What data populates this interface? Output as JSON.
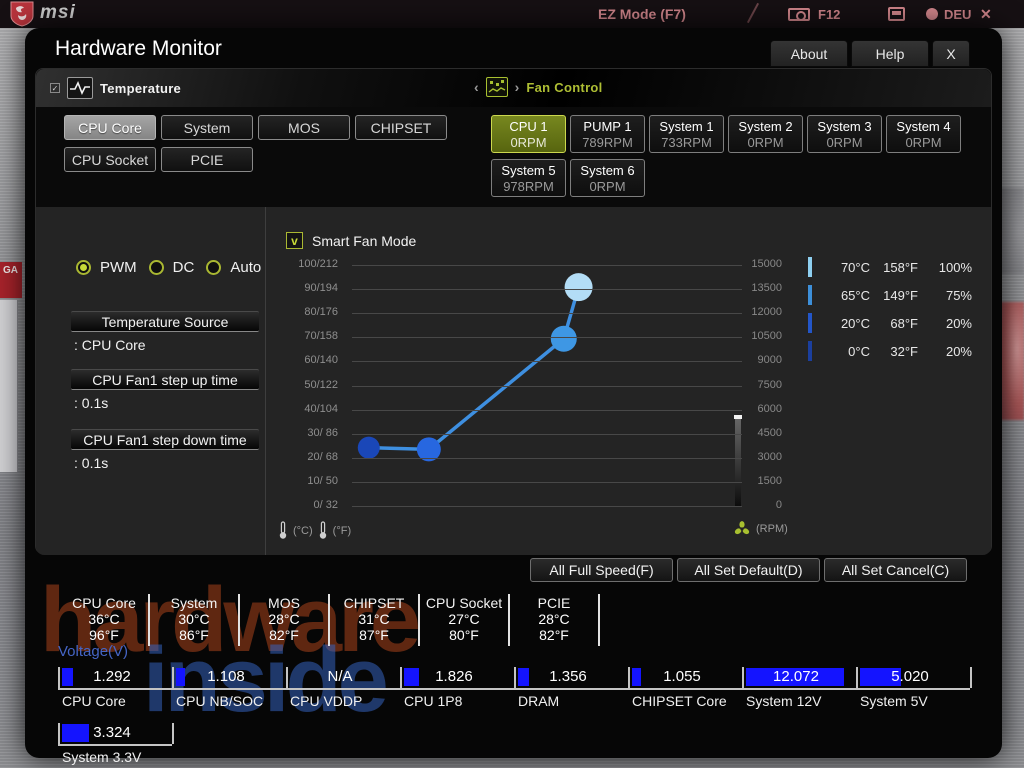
{
  "top_bar": {
    "brand": "msi",
    "ez_mode": "EZ Mode (F7)",
    "f12": "F12",
    "lang": "DEU",
    "close": "✕",
    "ga_badge": "GA"
  },
  "dialog": {
    "title": "Hardware Monitor",
    "tabs": [
      {
        "label": "About"
      },
      {
        "label": "Help"
      },
      {
        "label": "X"
      }
    ]
  },
  "temperature_section": {
    "title": "Temperature",
    "buttons": [
      {
        "label": "CPU Core",
        "selected": true
      },
      {
        "label": "System",
        "selected": false
      },
      {
        "label": "MOS",
        "selected": false
      },
      {
        "label": "CHIPSET",
        "selected": false
      },
      {
        "label": "CPU Socket",
        "selected": false
      },
      {
        "label": "PCIE",
        "selected": false
      }
    ]
  },
  "fan_section": {
    "title": "Fan Control",
    "prev": "‹",
    "next": "›",
    "fans": [
      {
        "name": "CPU 1",
        "rpm": "0RPM",
        "selected": true
      },
      {
        "name": "PUMP 1",
        "rpm": "789RPM",
        "selected": false
      },
      {
        "name": "System 1",
        "rpm": "733RPM",
        "selected": false
      },
      {
        "name": "System 2",
        "rpm": "0RPM",
        "selected": false
      },
      {
        "name": "System 3",
        "rpm": "0RPM",
        "selected": false
      },
      {
        "name": "System 4",
        "rpm": "0RPM",
        "selected": false
      },
      {
        "name": "System 5",
        "rpm": "978RPM",
        "selected": false
      },
      {
        "name": "System 6",
        "rpm": "0RPM",
        "selected": false
      }
    ]
  },
  "fan_controls": {
    "modes": [
      {
        "label": "PWM",
        "selected": true
      },
      {
        "label": "DC",
        "selected": false
      },
      {
        "label": "Auto",
        "selected": false
      }
    ],
    "fields": [
      {
        "button": "Temperature Source",
        "value": ": CPU Core"
      },
      {
        "button": "CPU Fan1 step up time",
        "value": ": 0.1s"
      },
      {
        "button": "CPU Fan1 step down time",
        "value": ": 0.1s"
      }
    ]
  },
  "chart_data": {
    "type": "line",
    "title": "Smart Fan Mode",
    "checkbox_checked": true,
    "check_glyph": "v",
    "x_axis": "Temperature (°C/°F)",
    "y_right_axis": "Fan speed (RPM)",
    "y_left_labels": [
      "100/212",
      "90/194",
      "80/176",
      "70/158",
      "60/140",
      "50/122",
      "40/104",
      "30/ 86",
      "20/ 68",
      "10/ 50",
      "0/ 32"
    ],
    "y_right_labels": [
      "15000",
      "13500",
      "12000",
      "10500",
      "9000",
      "7500",
      "6000",
      "4500",
      "3000",
      "1500",
      "0"
    ],
    "y_right_range": [
      0,
      15000
    ],
    "line_color": "#3e8fe0",
    "points": [
      {
        "temp_c": 0,
        "temp_f": 32,
        "duty_pct": 20,
        "x_pct": 4.3,
        "y_pct": 24.2,
        "r": 11,
        "color": "#1a47b8"
      },
      {
        "temp_c": 20,
        "temp_f": 68,
        "duty_pct": 20,
        "x_pct": 19.7,
        "y_pct": 23.5,
        "r": 12,
        "color": "#2767e0"
      },
      {
        "temp_c": 65,
        "temp_f": 149,
        "duty_pct": 75,
        "x_pct": 54.3,
        "y_pct": 69.4,
        "r": 13,
        "color": "#3e97e4"
      },
      {
        "temp_c": 70,
        "temp_f": 158,
        "duty_pct": 100,
        "x_pct": 58.1,
        "y_pct": 90.8,
        "r": 14,
        "color": "#b3ddf6"
      }
    ],
    "footer": {
      "celsius": "(°C)",
      "fahrenheit": "(°F)",
      "rpm": "(RPM)"
    },
    "legend": [
      {
        "c": "70°C",
        "f": "158°F",
        "pct": "100%",
        "color": "#8ecff0"
      },
      {
        "c": "65°C",
        "f": "149°F",
        "pct": "75%",
        "color": "#3d8fd9"
      },
      {
        "c": "20°C",
        "f": "68°F",
        "pct": "20%",
        "color": "#2356c8"
      },
      {
        "c": "0°C",
        "f": "32°F",
        "pct": "20%",
        "color": "#1b3f9e"
      }
    ]
  },
  "actions": [
    {
      "label": "All Full Speed(F)"
    },
    {
      "label": "All Set Default(D)"
    },
    {
      "label": "All Set Cancel(C)"
    }
  ],
  "monitor": {
    "temps": [
      {
        "name": "CPU Core",
        "c": "36°C",
        "f": "96°F"
      },
      {
        "name": "System",
        "c": "30°C",
        "f": "86°F"
      },
      {
        "name": "MOS",
        "c": "28°C",
        "f": "82°F"
      },
      {
        "name": "CHIPSET",
        "c": "31°C",
        "f": "87°F"
      },
      {
        "name": "CPU Socket",
        "c": "27°C",
        "f": "80°F"
      },
      {
        "name": "PCIE",
        "c": "28°C",
        "f": "82°F"
      }
    ],
    "voltage_label": "Voltage(V)",
    "bar_color": "#1414ff",
    "bar_full_scale": 13,
    "voltages": [
      {
        "name": "CPU Core",
        "value": "1.292",
        "volts": 1.292,
        "row": 1
      },
      {
        "name": "CPU NB/SOC",
        "value": "1.108",
        "volts": 1.108,
        "row": 1
      },
      {
        "name": "CPU VDDP",
        "value": "N/A",
        "volts": null,
        "row": 1
      },
      {
        "name": "CPU 1P8",
        "value": "1.826",
        "volts": 1.826,
        "row": 1
      },
      {
        "name": "DRAM",
        "value": "1.356",
        "volts": 1.356,
        "row": 1
      },
      {
        "name": "CHIPSET Core",
        "value": "1.055",
        "volts": 1.055,
        "row": 1
      },
      {
        "name": "System 12V",
        "value": "12.072",
        "volts": 12.072,
        "row": 1
      },
      {
        "name": "System 5V",
        "value": "5.020",
        "volts": 5.02,
        "row": 1
      },
      {
        "name": "System 3.3V",
        "value": "3.324",
        "volts": 3.324,
        "row": 2
      }
    ]
  },
  "watermark": {
    "line1": "hardware",
    "line2": "inside"
  },
  "accent": {
    "green": "#b9c93a"
  }
}
